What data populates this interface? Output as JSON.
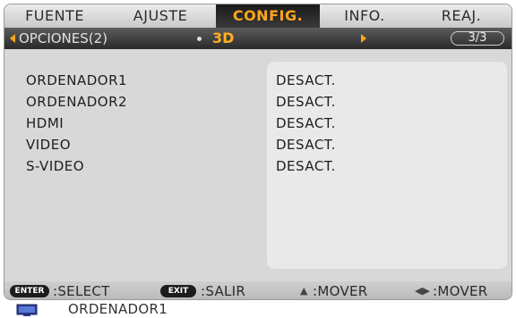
{
  "tabs": [
    "FUENTE",
    "AJUSTE",
    "CONFIG.",
    "INFO.",
    "REAJ."
  ],
  "active_tab": "CONFIG.",
  "subheader": {
    "section": "OPCIONES(2)",
    "selected": "3D",
    "page": "3/3"
  },
  "settings": [
    {
      "label": "ORDENADOR1",
      "value": "DESACT."
    },
    {
      "label": "ORDENADOR2",
      "value": "DESACT."
    },
    {
      "label": "HDMI",
      "value": "DESACT."
    },
    {
      "label": "VIDEO",
      "value": "DESACT."
    },
    {
      "label": "S-VIDEO",
      "value": "DESACT."
    }
  ],
  "footer": {
    "enter_key": "ENTER",
    "enter_label": ":SELECT",
    "exit_key": "EXIT",
    "exit_label": ":SALIR",
    "move_v_label": ":MOVER",
    "move_h_label": ":MOVER"
  },
  "source": {
    "icon": "computer-monitor-icon",
    "label": "ORDENADOR1"
  },
  "colors": {
    "accent": "#ffa51e",
    "tab_active_bg": "#222222",
    "panel_bg": "#d8d8d8"
  }
}
